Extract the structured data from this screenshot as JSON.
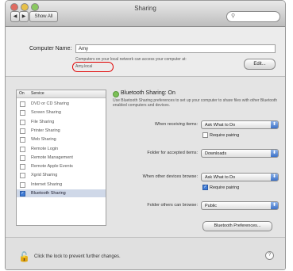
{
  "window": {
    "title": "Sharing",
    "nav_back": "◀",
    "nav_forward": "▶",
    "show_all": "Show All",
    "search_placeholder": ""
  },
  "computer": {
    "name_label": "Computer Name:",
    "name_value": "Amy",
    "description": "Computers on your local network can access your computer at:",
    "address": "Amy.local",
    "edit_label": "Edit..."
  },
  "services": {
    "header_on": "On",
    "header_service": "Service",
    "items": [
      {
        "label": "DVD or CD Sharing",
        "checked": false,
        "selected": false
      },
      {
        "label": "Screen Sharing",
        "checked": false,
        "selected": false
      },
      {
        "label": "File Sharing",
        "checked": false,
        "selected": false
      },
      {
        "label": "Printer Sharing",
        "checked": false,
        "selected": false
      },
      {
        "label": "Web Sharing",
        "checked": false,
        "selected": false
      },
      {
        "label": "Remote Login",
        "checked": false,
        "selected": false
      },
      {
        "label": "Remote Management",
        "checked": false,
        "selected": false
      },
      {
        "label": "Remote Apple Events",
        "checked": false,
        "selected": false
      },
      {
        "label": "Xgrid Sharing",
        "checked": false,
        "selected": false
      },
      {
        "label": "Internet Sharing",
        "checked": false,
        "selected": false
      },
      {
        "label": "Bluetooth Sharing",
        "checked": true,
        "selected": true
      }
    ]
  },
  "bluetooth": {
    "status": "Bluetooth Sharing: On",
    "description": "Use Bluetooth Sharing preferences to set up your computer to share files with other Bluetooth enabled computers and devices.",
    "receiving_label": "When receiving items:",
    "receiving_value": "Ask What to Do",
    "require_pairing_1": "Require pairing",
    "require_pairing_1_checked": false,
    "folder_label": "Folder for accepted items:",
    "folder_value": "Downloads",
    "browse_label": "When other devices browse:",
    "browse_value": "Ask What to Do",
    "require_pairing_2": "Require pairing",
    "require_pairing_2_checked": true,
    "browse_folder_label": "Folder others can browse:",
    "browse_folder_value": "Public",
    "prefs_button": "Bluetooth Preferences..."
  },
  "footer": {
    "lock_text": "Click the lock to prevent further changes.",
    "help": "?"
  },
  "colors": {
    "status_on": "#7cc057",
    "highlight_ring": "#e00000",
    "popup_arrow": "#3c71c7"
  }
}
